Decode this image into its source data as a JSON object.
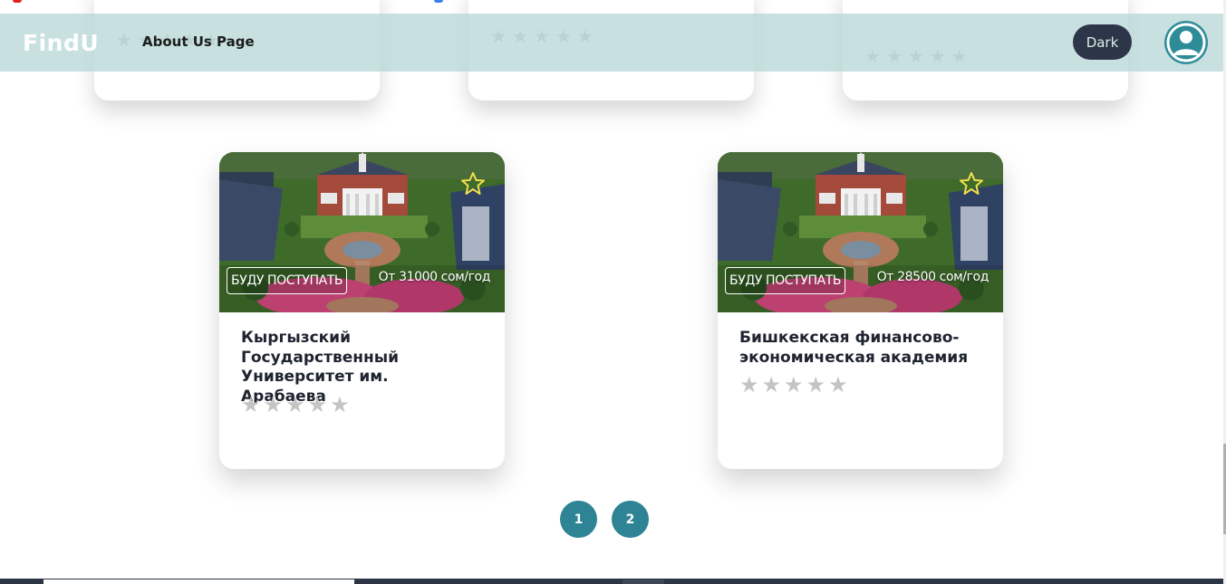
{
  "header": {
    "logo": "FindU",
    "nav_about": "About Us Page",
    "theme_button": "Dark"
  },
  "universities": [
    {
      "apply_label": "БУДУ ПОСТУПАТЬ",
      "price": "От 31000 сом/год",
      "name": "Кыргызский Государственный Университет им. Арабаева",
      "rating": 0,
      "stars": [
        "★",
        "★",
        "★",
        "★",
        "★"
      ]
    },
    {
      "apply_label": "БУДУ ПОСТУПАТЬ",
      "price": "От 28500 сом/год",
      "name": "Бишкекская финансово-экономическая академия",
      "rating": 0,
      "stars": [
        "★",
        "★",
        "★",
        "★",
        "★"
      ]
    }
  ],
  "pagination": {
    "pages": [
      "1",
      "2"
    ],
    "current": "2"
  },
  "colors": {
    "header_bg": "#b9d9d7",
    "accent": "#2e8494",
    "dark_button": "#2c3648",
    "favorite_star": "#f2e04a"
  }
}
